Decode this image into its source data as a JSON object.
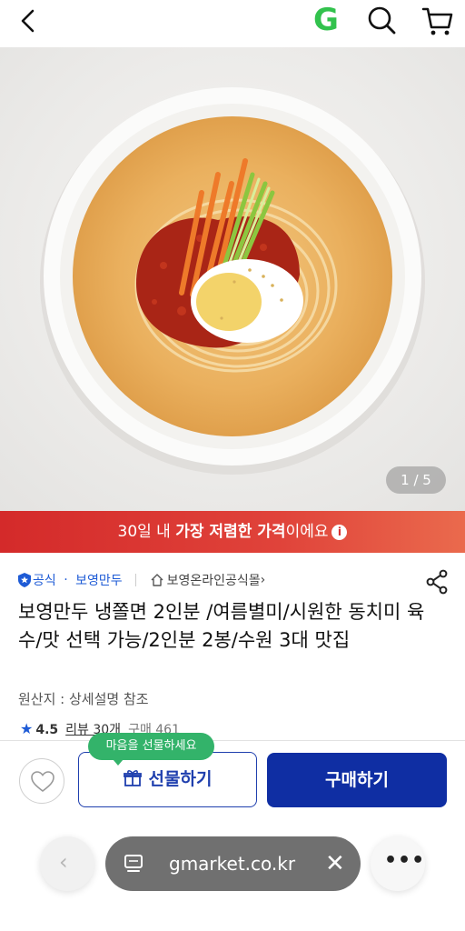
{
  "header": {
    "logo_letter": "G",
    "back_icon": "chevron-left-icon",
    "search_icon": "search-icon",
    "cart_icon": "cart-icon"
  },
  "gallery": {
    "indicator": "1 / 5",
    "image_alt": "냉쫄면"
  },
  "banner": {
    "text_prefix": "30일 내 ",
    "text_highlight": "가장 저렴한 가격",
    "text_suffix": "이에요",
    "info_icon": "i"
  },
  "seller": {
    "official_label": "공식",
    "brand": "보영만두",
    "store": "보영온라인공식몰",
    "chevron": "›"
  },
  "product": {
    "title": "보영만두 냉쫄면 2인분 /여름별미/시원한 동치미 육수/맛 선택 가능/2인분 2봉/수원 3대 맛집",
    "origin": "원산지 : 상세설명 참조",
    "rating": "4.5",
    "review_text": "리뷰 30개",
    "purchase_text": "구매 461"
  },
  "actions": {
    "gift_tooltip": "마음을 선물하세요",
    "gift_label": "선물하기",
    "buy_label": "구매하기"
  },
  "browser": {
    "url": "gmarket.co.kr",
    "close_symbol": "✕",
    "back_symbol": "‹",
    "more_symbol": "•••"
  },
  "colors": {
    "brand_blue": "#0f2ea3",
    "banner_red": "#d42a2a",
    "tooltip_green": "#33b36a",
    "logo_green": "#32c24d"
  }
}
